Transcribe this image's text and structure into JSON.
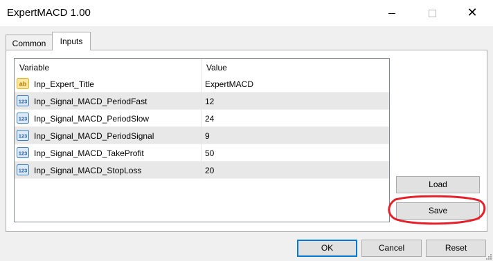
{
  "window": {
    "title": "ExpertMACD 1.00",
    "minimize_icon": "minimize-icon",
    "maximize_icon": "maximize-icon",
    "close_icon": "close-icon",
    "close_glyph": "✕"
  },
  "tabs": [
    {
      "label": "Common",
      "active": false
    },
    {
      "label": "Inputs",
      "active": true
    }
  ],
  "grid": {
    "columns": [
      "Variable",
      "Value"
    ],
    "rows": [
      {
        "icon": "string-type-icon",
        "name": "Inp_Expert_Title",
        "value": "ExpertMACD"
      },
      {
        "icon": "integer-type-icon",
        "name": "Inp_Signal_MACD_PeriodFast",
        "value": "12"
      },
      {
        "icon": "integer-type-icon",
        "name": "Inp_Signal_MACD_PeriodSlow",
        "value": "24"
      },
      {
        "icon": "integer-type-icon",
        "name": "Inp_Signal_MACD_PeriodSignal",
        "value": "9"
      },
      {
        "icon": "integer-type-icon",
        "name": "Inp_Signal_MACD_TakeProfit",
        "value": "50"
      },
      {
        "icon": "integer-type-icon",
        "name": "Inp_Signal_MACD_StopLoss",
        "value": "20"
      }
    ]
  },
  "side_buttons": {
    "load": "Load",
    "save": "Save"
  },
  "footer_buttons": {
    "ok": "OK",
    "cancel": "Cancel",
    "reset": "Reset"
  },
  "colors": {
    "highlight_ellipse": "#e4202a",
    "default_button_border": "#0078d7",
    "string_icon": "#e6b422",
    "integer_icon": "#3c7fc1"
  }
}
